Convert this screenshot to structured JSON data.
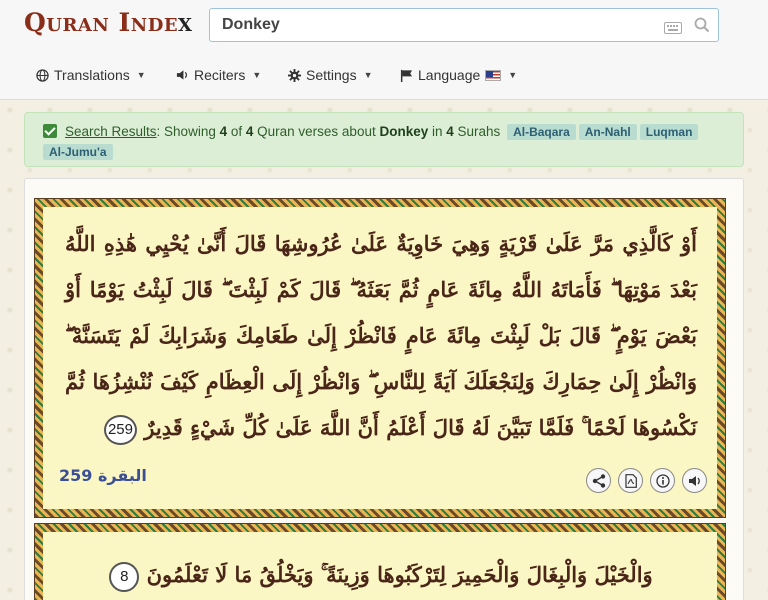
{
  "header": {
    "logo_main": "Quran Inde",
    "logo_x": "x",
    "search": {
      "value": "Donkey",
      "placeholder": ""
    },
    "nav": [
      {
        "label": "Translations",
        "icon": "globe-icon"
      },
      {
        "label": "Reciters",
        "icon": "speaker-icon"
      },
      {
        "label": "Settings",
        "icon": "gear-icon"
      },
      {
        "label": "Language",
        "icon": "flag-icon"
      }
    ]
  },
  "alert": {
    "link_text": "Search Results",
    "text_1": ": Showing ",
    "shown_count": "4",
    "text_2": " of ",
    "total_count": "4",
    "text_3": " Quran verses about ",
    "query": "Donkey",
    "text_4": " in ",
    "surah_count": "4",
    "text_5": " Surahs",
    "surahs": [
      "Al-Baqara",
      "An-Nahl",
      "Luqman",
      "Al-Jumu'a"
    ]
  },
  "results": [
    {
      "text": "أَوْ كَالَّذِي مَرَّ عَلَىٰ قَرْيَةٍ وَهِيَ خَاوِيَةٌ عَلَىٰ عُرُوشِهَا قَالَ أَنَّىٰ يُحْيِي هَٰذِهِ اللَّهُ بَعْدَ مَوْتِهَا ۖ فَأَمَاتَهُ اللَّهُ مِائَةَ عَامٍ ثُمَّ بَعَثَهُ ۖ قَالَ كَمْ لَبِثْتَ ۖ قَالَ لَبِثْتُ يَوْمًا أَوْ بَعْضَ يَوْمٍ ۖ قَالَ بَلْ لَبِثْتَ مِائَةَ عَامٍ فَانْظُرْ إِلَىٰ طَعَامِكَ وَشَرَابِكَ لَمْ يَتَسَنَّهْ ۖ وَانْظُرْ إِلَىٰ حِمَارِكَ وَلِنَجْعَلَكَ آيَةً لِلنَّاسِ ۖ وَانْظُرْ إِلَى الْعِظَامِ كَيْفَ نُنْشِزُهَا ثُمَّ نَكْسُوهَا لَحْمًا ۚ فَلَمَّا تَبَيَّنَ لَهُ قَالَ أَعْلَمُ أَنَّ اللَّهَ عَلَىٰ كُلِّ شَيْءٍ قَدِيرٌ",
      "number": "259",
      "ref": "البقرة 259"
    },
    {
      "text": "وَالْخَيْلَ وَالْبِغَالَ وَالْحَمِيرَ لِتَرْكَبُوهَا وَزِينَةً ۚ وَيَخْلُقُ مَا لَا تَعْلَمُونَ",
      "number": "8"
    }
  ],
  "actions": [
    "share-icon",
    "pdf-icon",
    "info-icon",
    "audio-icon"
  ],
  "colors": {
    "logo": "#8a2e1a",
    "verse_text": "#4a2618",
    "verse_bg": "#fbf7c4",
    "alert_bg": "#dcefd6",
    "tag_bg": "#b9dcd0",
    "ref": "#3a4f95"
  }
}
